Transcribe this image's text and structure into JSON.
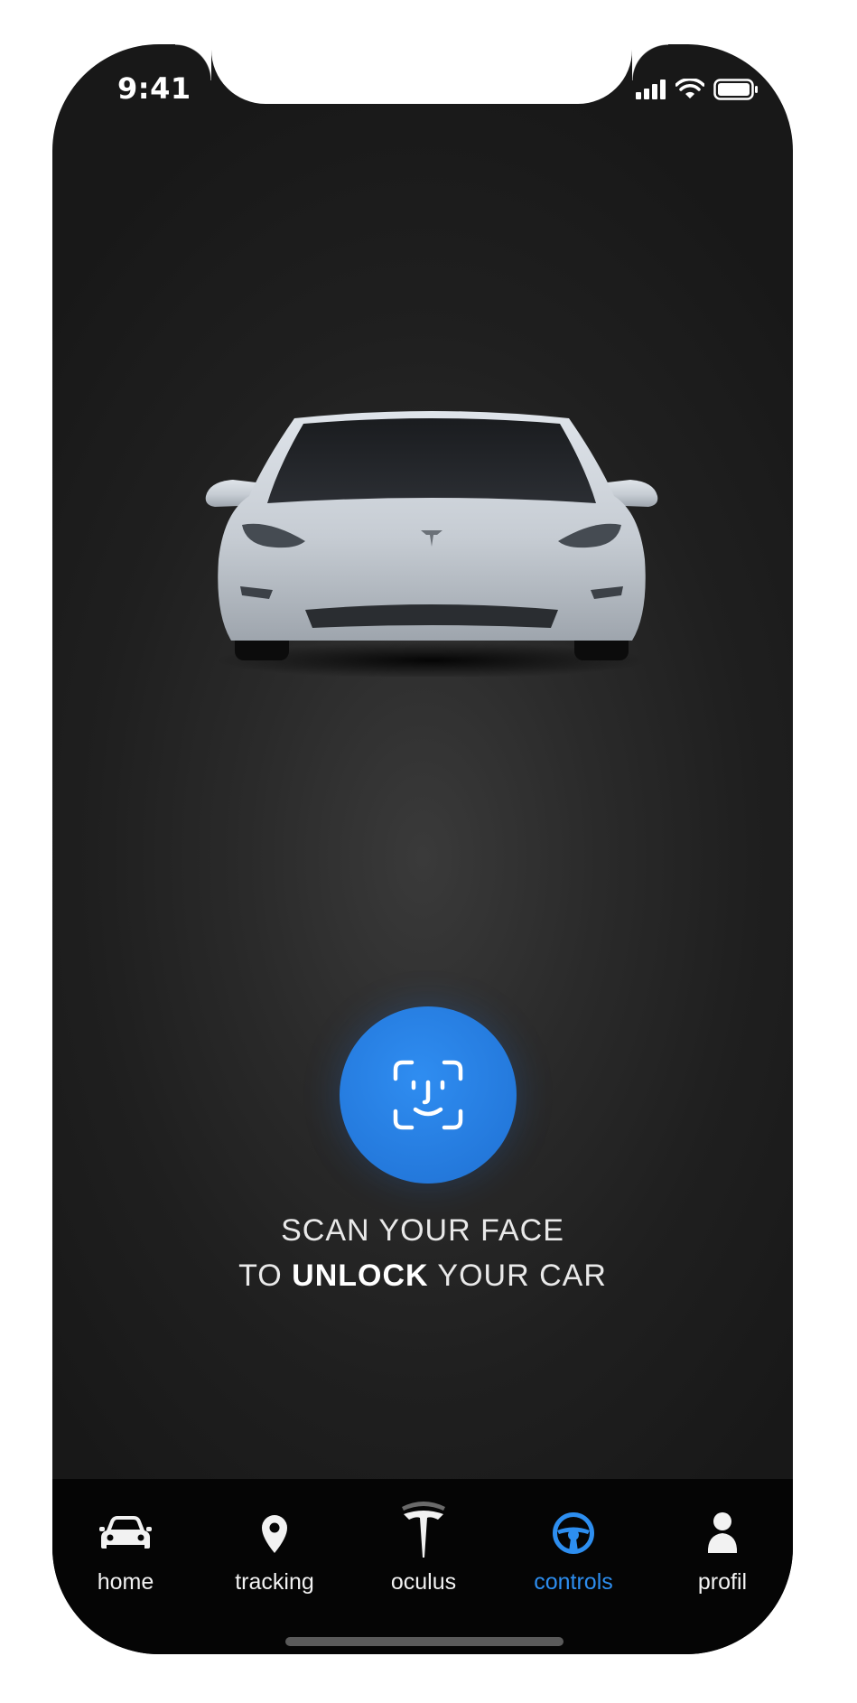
{
  "status_bar": {
    "time": "9:41"
  },
  "scan": {
    "line1": "SCAN YOUR FACE",
    "line2_prefix": "TO ",
    "line2_bold": "UNLOCK",
    "line2_suffix": " YOUR CAR"
  },
  "tabs": [
    {
      "label": "home",
      "icon": "car-icon"
    },
    {
      "label": "tracking",
      "icon": "location-pin-icon"
    },
    {
      "label": "oculus",
      "icon": "tesla-logo-icon"
    },
    {
      "label": "controls",
      "icon": "steering-wheel-icon"
    },
    {
      "label": "profil",
      "icon": "person-icon"
    }
  ],
  "active_tab": "controls",
  "colors": {
    "accent": "#2d8ef0",
    "button": "#2479dc",
    "background": "#1f1f1f",
    "tabbar": "#050505"
  }
}
